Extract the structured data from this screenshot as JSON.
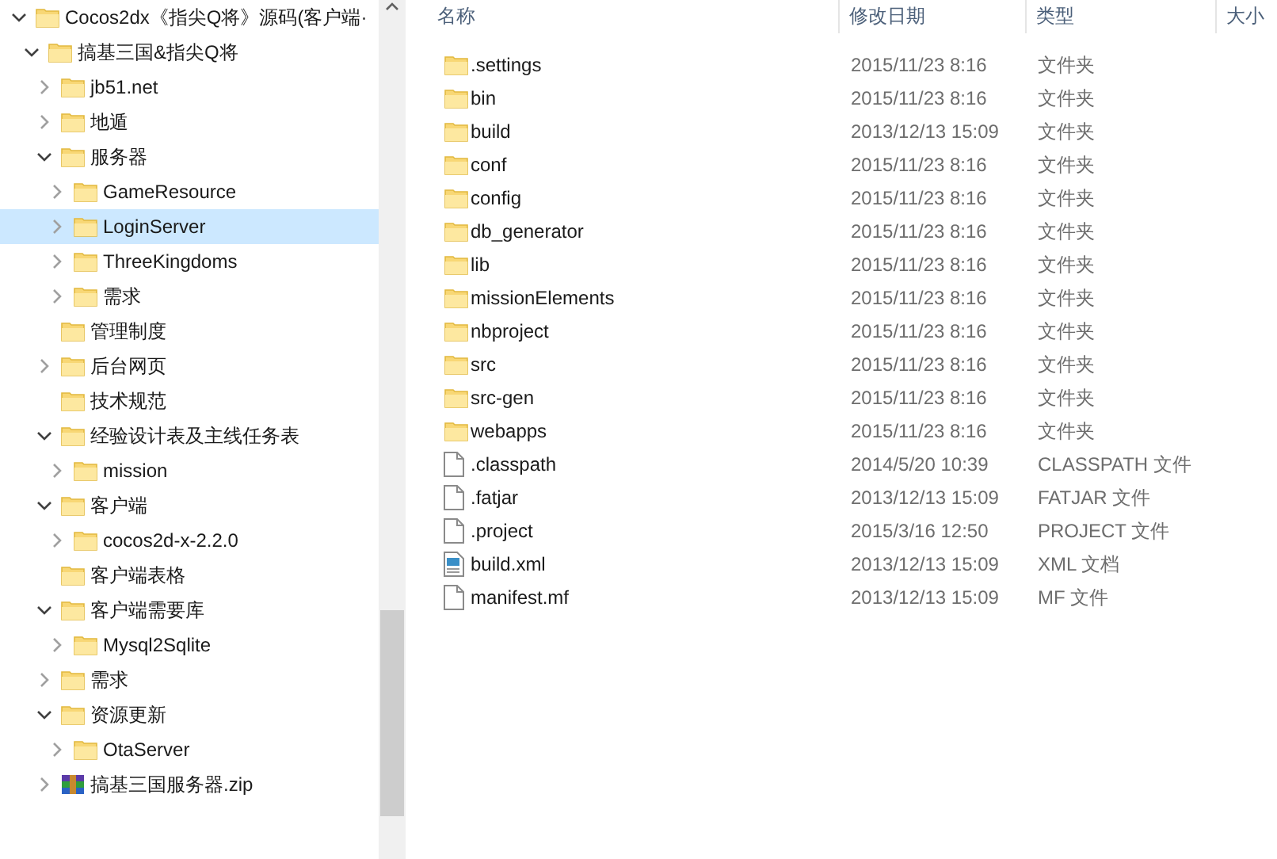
{
  "navigation_tree": [
    {
      "label": "Cocos2dx《指尖Q将》源码(客户端·",
      "kind": "folder",
      "expandable": true,
      "expanded": true,
      "selected": false,
      "children": [
        {
          "label": "搞基三国&指尖Q将",
          "kind": "folder",
          "expandable": true,
          "expanded": true,
          "selected": false,
          "children": [
            {
              "label": "jb51.net",
              "kind": "folder",
              "expandable": true,
              "expanded": false,
              "selected": false
            },
            {
              "label": "地遁",
              "kind": "folder",
              "expandable": true,
              "expanded": false,
              "selected": false
            },
            {
              "label": "服务器",
              "kind": "folder",
              "expandable": true,
              "expanded": true,
              "selected": false,
              "children": [
                {
                  "label": "GameResource",
                  "kind": "folder",
                  "expandable": true,
                  "expanded": false,
                  "selected": false
                },
                {
                  "label": "LoginServer",
                  "kind": "folder",
                  "expandable": true,
                  "expanded": false,
                  "selected": true
                },
                {
                  "label": "ThreeKingdoms",
                  "kind": "folder",
                  "expandable": true,
                  "expanded": false,
                  "selected": false
                },
                {
                  "label": "需求",
                  "kind": "folder",
                  "expandable": true,
                  "expanded": false,
                  "selected": false
                }
              ]
            },
            {
              "label": "管理制度",
              "kind": "folder",
              "expandable": false,
              "selected": false
            },
            {
              "label": "后台网页",
              "kind": "folder",
              "expandable": true,
              "expanded": false,
              "selected": false
            },
            {
              "label": "技术规范",
              "kind": "folder",
              "expandable": false,
              "selected": false
            },
            {
              "label": "经验设计表及主线任务表",
              "kind": "folder",
              "expandable": true,
              "expanded": true,
              "selected": false,
              "children": [
                {
                  "label": "mission",
                  "kind": "folder",
                  "expandable": true,
                  "expanded": false,
                  "selected": false
                }
              ]
            },
            {
              "label": "客户端",
              "kind": "folder",
              "expandable": true,
              "expanded": true,
              "selected": false,
              "children": [
                {
                  "label": "cocos2d-x-2.2.0",
                  "kind": "folder",
                  "expandable": true,
                  "expanded": false,
                  "selected": false
                }
              ]
            },
            {
              "label": "客户端表格",
              "kind": "folder",
              "expandable": false,
              "selected": false
            },
            {
              "label": "客户端需要库",
              "kind": "folder",
              "expandable": true,
              "expanded": true,
              "selected": false,
              "children": [
                {
                  "label": "Mysql2Sqlite",
                  "kind": "folder",
                  "expandable": true,
                  "expanded": false,
                  "selected": false
                }
              ]
            },
            {
              "label": "需求",
              "kind": "folder",
              "expandable": true,
              "expanded": false,
              "selected": false
            },
            {
              "label": "资源更新",
              "kind": "folder",
              "expandable": true,
              "expanded": true,
              "selected": false,
              "children": [
                {
                  "label": "OtaServer",
                  "kind": "folder",
                  "expandable": true,
                  "expanded": false,
                  "selected": false
                }
              ]
            },
            {
              "label": "搞基三国服务器.zip",
              "kind": "archive",
              "expandable": true,
              "expanded": false,
              "selected": false
            }
          ]
        }
      ]
    }
  ],
  "file_list": {
    "columns": [
      "名称",
      "修改日期",
      "类型",
      "大小"
    ],
    "rows": [
      {
        "name": ".settings",
        "date": "2015/11/23 8:16",
        "type": "文件夹",
        "kind": "folder"
      },
      {
        "name": "bin",
        "date": "2015/11/23 8:16",
        "type": "文件夹",
        "kind": "folder"
      },
      {
        "name": "build",
        "date": "2013/12/13 15:09",
        "type": "文件夹",
        "kind": "folder"
      },
      {
        "name": "conf",
        "date": "2015/11/23 8:16",
        "type": "文件夹",
        "kind": "folder"
      },
      {
        "name": "config",
        "date": "2015/11/23 8:16",
        "type": "文件夹",
        "kind": "folder"
      },
      {
        "name": "db_generator",
        "date": "2015/11/23 8:16",
        "type": "文件夹",
        "kind": "folder"
      },
      {
        "name": "lib",
        "date": "2015/11/23 8:16",
        "type": "文件夹",
        "kind": "folder"
      },
      {
        "name": "missionElements",
        "date": "2015/11/23 8:16",
        "type": "文件夹",
        "kind": "folder"
      },
      {
        "name": "nbproject",
        "date": "2015/11/23 8:16",
        "type": "文件夹",
        "kind": "folder"
      },
      {
        "name": "src",
        "date": "2015/11/23 8:16",
        "type": "文件夹",
        "kind": "folder"
      },
      {
        "name": "src-gen",
        "date": "2015/11/23 8:16",
        "type": "文件夹",
        "kind": "folder"
      },
      {
        "name": "webapps",
        "date": "2015/11/23 8:16",
        "type": "文件夹",
        "kind": "folder"
      },
      {
        "name": ".classpath",
        "date": "2014/5/20 10:39",
        "type": "CLASSPATH 文件",
        "kind": "file"
      },
      {
        "name": ".fatjar",
        "date": "2013/12/13 15:09",
        "type": "FATJAR 文件",
        "kind": "file"
      },
      {
        "name": ".project",
        "date": "2015/3/16 12:50",
        "type": "PROJECT 文件",
        "kind": "file"
      },
      {
        "name": "build.xml",
        "date": "2013/12/13 15:09",
        "type": "XML 文档",
        "kind": "xml"
      },
      {
        "name": "manifest.mf",
        "date": "2013/12/13 15:09",
        "type": "MF 文件",
        "kind": "file"
      }
    ]
  }
}
